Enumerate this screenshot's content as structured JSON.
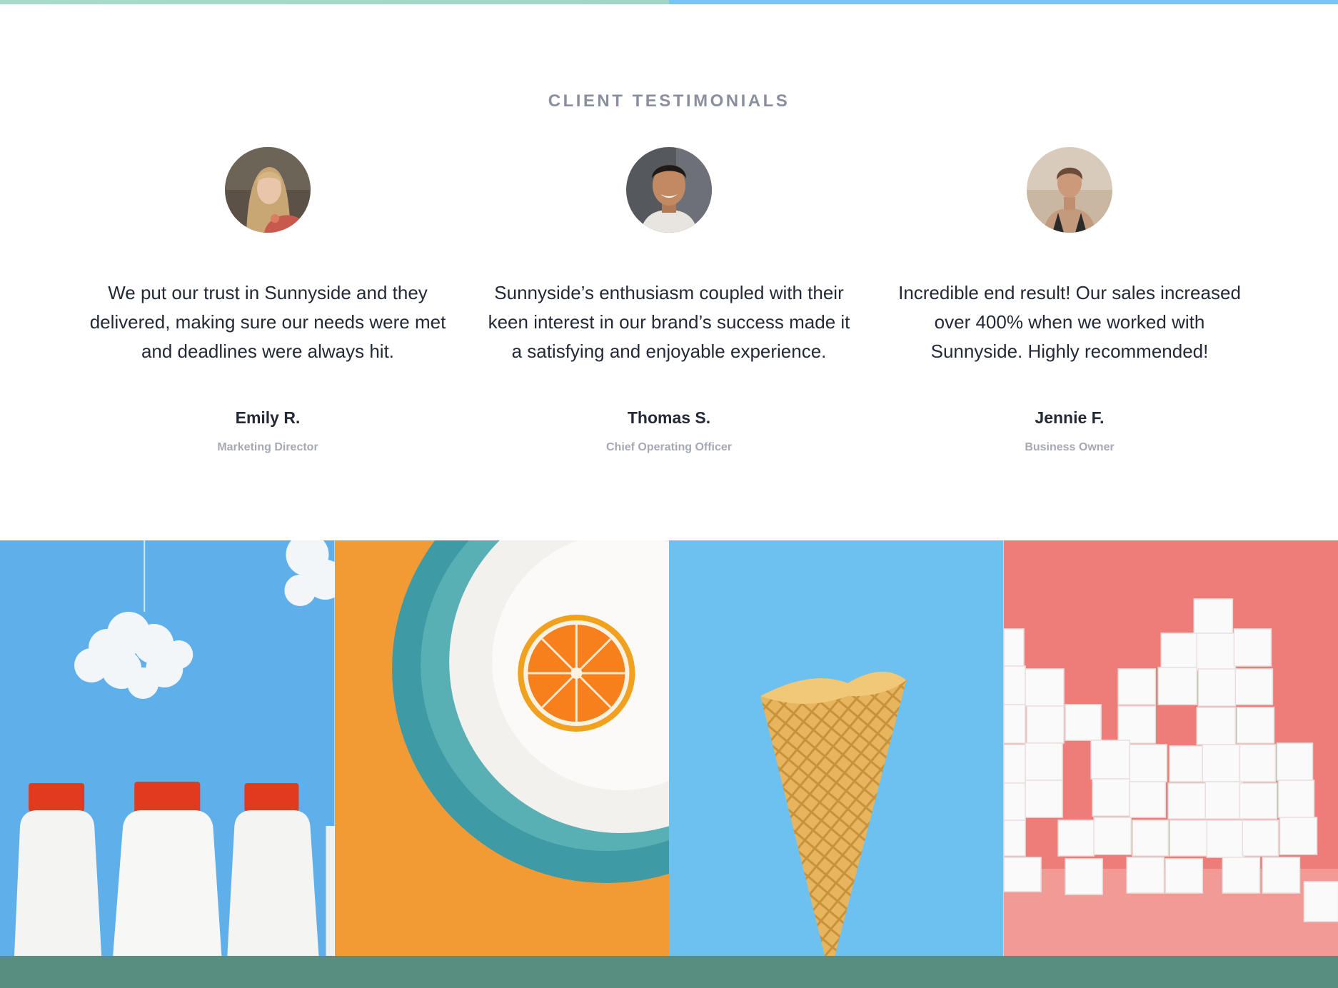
{
  "section": {
    "title": "CLIENT TESTIMONIALS"
  },
  "testimonials": [
    {
      "quote": "We put our trust in Sunnyside and they delivered, making sure our needs were met and deadlines were always hit.",
      "name": "Emily R.",
      "role": "Marketing Director"
    },
    {
      "quote": "Sunnyside’s enthusiasm coupled with their keen interest in our brand’s success made it a satisfying and enjoyable experience.",
      "name": "Thomas S.",
      "role": "Chief Operating Officer"
    },
    {
      "quote": "Incredible end result! Our sales increased over 400% when we worked with Sunnyside. Highly recommended!",
      "name": "Jennie F.",
      "role": "Business Owner"
    }
  ],
  "colors": {
    "title": "#8a8f9e",
    "text": "#232a36",
    "muted": "#a5a9b4",
    "footer": "#578e80",
    "sky_blue": "#6cc1f1",
    "orange": "#f29b34",
    "coral": "#ee7d79"
  },
  "gallery": [
    "milk-bottles-image",
    "orange-plate-image",
    "ice-cream-cone-image",
    "sugar-cubes-image"
  ]
}
